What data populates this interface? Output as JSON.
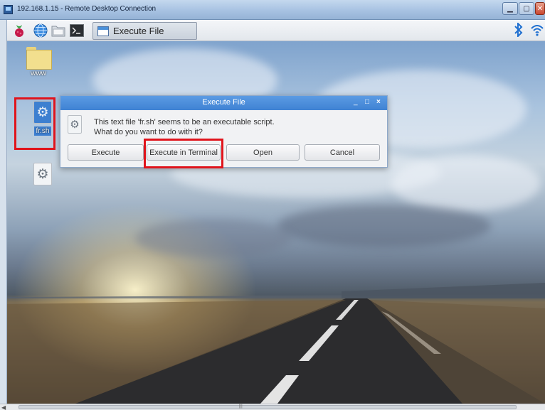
{
  "rdp_window": {
    "title": "192.168.1.15 - Remote Desktop Connection",
    "icon": "remote-desktop-icon"
  },
  "panel": {
    "launchers": [
      "raspberry-menu-icon",
      "globe-icon",
      "folder-icon",
      "terminal-icon"
    ],
    "taskbar_item_label": "Execute File",
    "tray_icons": [
      "bluetooth-icon",
      "wifi-icon"
    ],
    "accent_color": "#1f6fd0"
  },
  "desktop": {
    "icons": [
      {
        "label": "www",
        "icon": "folder-icon"
      },
      {
        "label": "fr.sh",
        "icon": "script-file-icon",
        "selected": true
      },
      {
        "label": "",
        "icon": "script-file-icon"
      }
    ]
  },
  "dialog": {
    "title": "Execute File",
    "controls": {
      "minimize": "_",
      "maximize": "□",
      "close": "×"
    },
    "message_line1": "This text file 'fr.sh' seems to be an executable script.",
    "message_line2": "What do you want to do with it?",
    "buttons": {
      "execute": "Execute",
      "execute_in_terminal": "Execute in Terminal",
      "open": "Open",
      "cancel": "Cancel"
    },
    "titlebar_color": "#4a8ddb"
  },
  "annotations": {
    "highlight_color": "#e0141c"
  }
}
